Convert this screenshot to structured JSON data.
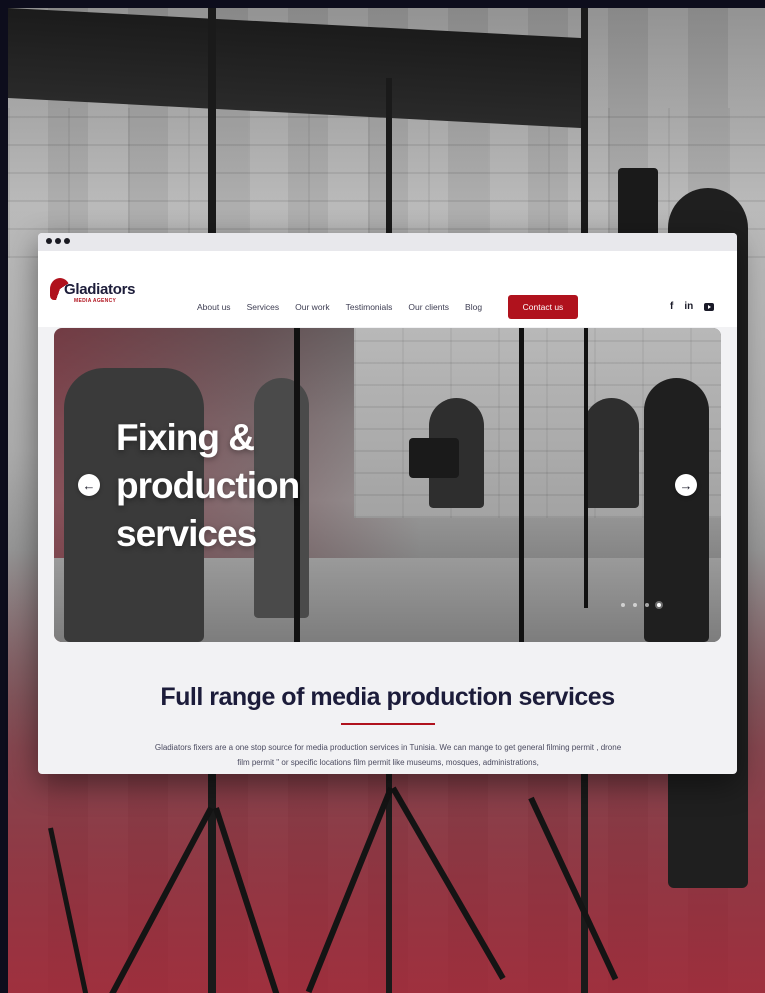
{
  "window": {
    "controls": [
      "close",
      "minimize",
      "maximize"
    ]
  },
  "brand": {
    "logo_text": "Gladiators",
    "logo_subtext": "MEDIA AGENCY",
    "accent_color": "#b0121d",
    "dark_color": "#1c1c3a"
  },
  "nav": {
    "items": [
      {
        "label": "About us"
      },
      {
        "label": "Services"
      },
      {
        "label": "Our work"
      },
      {
        "label": "Testimonials"
      },
      {
        "label": "Our clients"
      },
      {
        "label": "Blog"
      }
    ],
    "cta_label": "Contact us",
    "social": [
      {
        "label": "f",
        "icon": "facebook-icon"
      },
      {
        "label": "in",
        "icon": "linkedin-icon"
      },
      {
        "label": "",
        "icon": "youtube-icon"
      }
    ]
  },
  "hero": {
    "title": "Fixing & production services",
    "prev_icon": "←",
    "next_icon": "→",
    "slides_count": 4,
    "active_slide": 4
  },
  "section": {
    "title": "Full range of media production services",
    "body": "Gladiators fixers are a one stop source for media production services in Tunisia. We can mange to get general filming permit , drone film permit \" or specific locations film permit like museums, mosques, administrations,"
  }
}
